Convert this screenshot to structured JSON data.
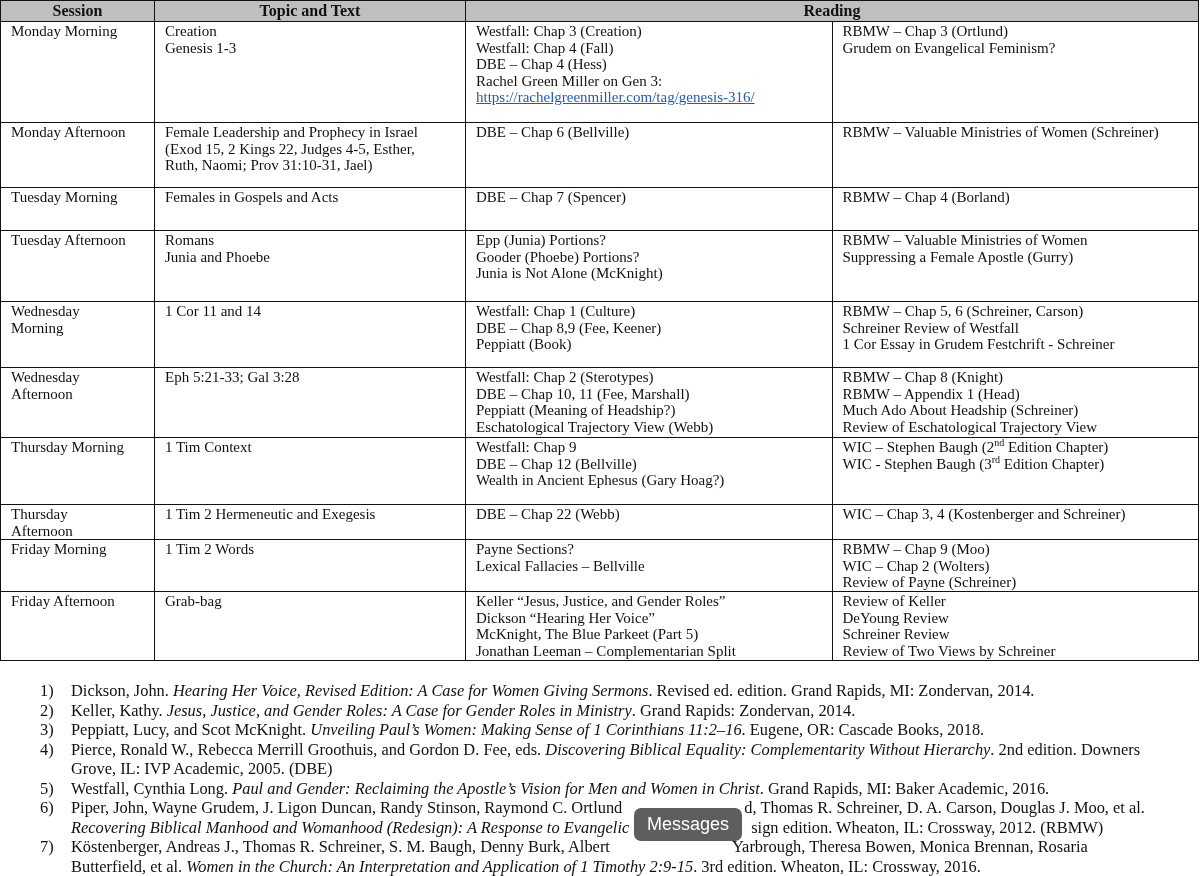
{
  "table": {
    "columns": [
      "Session",
      "Topic and Text",
      "Reading"
    ],
    "rows": [
      {
        "session": [
          "Monday Morning"
        ],
        "topic": [
          "Creation",
          "Genesis 1-3"
        ],
        "reading_1": [
          "Westfall: Chap 3 (Creation)",
          "Westfall: Chap 4 (Fall)",
          "DBE – Chap 4 (Hess)",
          "Rachel Green Miller on Gen 3:"
        ],
        "link": "https://rachelgreenmiller.com/tag/genesis-316/",
        "reading_2": [
          "RBMW – Chap 3 (Ortlund)",
          "Grudem on Evangelical Feminism?"
        ]
      },
      {
        "session": [
          "Monday Afternoon"
        ],
        "topic": [
          "Female Leadership and Prophecy in Israel",
          "(Exod 15, 2 Kings 22, Judges 4-5, Esther,",
          "Ruth, Naomi; Prov 31:10-31, Jael)"
        ],
        "reading_1": [
          "DBE – Chap 6 (Bellville)"
        ],
        "reading_2": [
          "RBMW – Valuable Ministries of Women (Schreiner)"
        ]
      },
      {
        "session": [
          "Tuesday Morning"
        ],
        "topic": [
          "Females in Gospels and Acts"
        ],
        "reading_1": [
          "DBE – Chap 7 (Spencer)"
        ],
        "reading_2": [
          "RBMW – Chap 4 (Borland)"
        ]
      },
      {
        "session": [
          "Tuesday Afternoon"
        ],
        "topic": [
          "Romans",
          "Junia and Phoebe"
        ],
        "reading_1": [
          "Epp (Junia) Portions?",
          "Gooder (Phoebe) Portions?",
          "Junia is Not Alone (McKnight)"
        ],
        "reading_2": [
          "RBMW – Valuable Ministries of Women",
          "Suppressing a Female Apostle (Gurry)"
        ]
      },
      {
        "session": [
          "Wednesday",
          "Morning"
        ],
        "topic": [
          "1 Cor 11 and 14"
        ],
        "reading_1": [
          "Westfall: Chap 1 (Culture)",
          "DBE – Chap 8,9 (Fee, Keener)",
          "Peppiatt (Book)"
        ],
        "reading_2": [
          "RBMW – Chap 5, 6 (Schreiner, Carson)",
          "Schreiner Review of Westfall",
          "1 Cor Essay in Grudem Festchrift - Schreiner"
        ]
      },
      {
        "session": [
          "Wednesday",
          "Afternoon"
        ],
        "topic": [
          "Eph 5:21-33; Gal 3:28"
        ],
        "reading_1": [
          "Westfall: Chap 2 (Sterotypes)",
          "DBE – Chap 10, 11 (Fee, Marshall)",
          "Peppiatt (Meaning of Headship?)",
          "Eschatological Trajectory View (Webb)"
        ],
        "reading_2": [
          "RBMW – Chap 8 (Knight)",
          "RBMW – Appendix 1 (Head)",
          "Much Ado About Headship (Schreiner)",
          "Review of Eschatological Trajectory View"
        ]
      },
      {
        "session": [
          "Thursday Morning"
        ],
        "topic": [
          "1 Tim Context"
        ],
        "reading_1": [
          "Westfall: Chap 9",
          "DBE – Chap 12 (Bellville)",
          "Wealth in Ancient Ephesus (Gary Hoag?)"
        ],
        "reading_2": [
          "WIC – Stephen Baugh (2$^{nd}$ Edition Chapter)",
          "WIC -  Stephen Baugh (3$^{rd}$ Edition Chapter)"
        ]
      },
      {
        "session": [
          "Thursday",
          "Afternoon"
        ],
        "topic": [
          "1 Tim 2 Hermeneutic and Exegesis"
        ],
        "reading_1": [
          "DBE – Chap 22 (Webb)"
        ],
        "reading_2": [
          "WIC – Chap 3, 4 (Kostenberger and Schreiner)"
        ]
      },
      {
        "session": [
          "Friday Morning"
        ],
        "topic": [
          "1 Tim 2 Words"
        ],
        "reading_1": [
          "Payne Sections?",
          "Lexical Fallacies – Bellville"
        ],
        "reading_2": [
          "RBMW – Chap 9 (Moo)",
          "WIC – Chap 2 (Wolters)",
          "Review of Payne (Schreiner)"
        ]
      },
      {
        "session": [
          "Friday Afternoon"
        ],
        "topic": [
          "Grab-bag"
        ],
        "reading_1": [
          "Keller “Jesus, Justice, and Gender Roles”",
          "Dickson “Hearing Her Voice”",
          "McKnight, The Blue Parkeet (Part 5)",
          "Jonathan Leeman – Complementarian Split"
        ],
        "reading_2": [
          "Review of Keller",
          "DeYoung Review",
          "Schreiner Review",
          "Review of Two Views by Schreiner"
        ]
      }
    ]
  },
  "references": [
    {
      "number": "1)",
      "lines": [
        [
          "Dickson, John. *Hearing Her Voice, Revised Edition: A Case for Women Giving Sermons*. Revised ed. edition. Grand Rapids, MI: Zondervan, 2014."
        ]
      ]
    },
    {
      "number": "2)",
      "lines": [
        [
          "Keller, Kathy. *Jesus, Justice, and Gender Roles: A Case for Gender Roles in Ministry*. Grand Rapids: Zondervan, 2014."
        ]
      ]
    },
    {
      "number": "3)",
      "lines": [
        [
          "Peppiatt, Lucy, and Scot McKnight. *Unveiling Paul’s Women: Making Sense of 1 Corinthians 11:2–16*. Eugene, OR: Cascade Books, 2018."
        ]
      ]
    },
    {
      "number": "4)",
      "lines": [
        [
          "Pierce, Ronald W., Rebecca Merrill Groothuis, and Gordon D. Fee, eds. *Discovering Biblical Equality: Complementarity Without Hierarchy*. 2nd edition. Downers"
        ],
        [
          "Grove, IL: IVP Academic, 2005. (DBE)"
        ]
      ]
    },
    {
      "number": "5)",
      "lines": [
        [
          "Westfall, Cynthia Long. *Paul and Gender: Reclaiming the Apostle’s Vision for Men and Women in Christ*. Grand Rapids, MI: Baker Academic, 2016."
        ]
      ]
    },
    {
      "number": "6)",
      "lines": [
        [
          "Piper, John, Wayne Grudem, J. Ligon Duncan, Randy Stinson, Raymond C. Ortlund",
          "d, Thomas R. Schreiner, D. A. Carson, Douglas J. Moo, et al."
        ],
        [
          "*Recovering Biblical Manhood and Womanhood (Redesign): A Response to Evangelic*",
          "sign edition. Wheaton, IL: Crossway, 2012. (RBMW)"
        ]
      ]
    },
    {
      "number": "7)",
      "lines": [
        [
          "Köstenberger, Andreas J., Thomas R. Schreiner, S. M. Baugh, Denny Burk, Albert",
          "Yarbrough, Theresa Bowen, Monica Brennan, Rosaria"
        ],
        [
          "Butterfield, et al. *Women in the Church: An Interpretation and Application of 1 Timothy 2:9-15*. 3rd edition. Wheaton, IL: Crossway, 2016."
        ]
      ]
    }
  ],
  "tooltip": {
    "text": "Messages"
  }
}
